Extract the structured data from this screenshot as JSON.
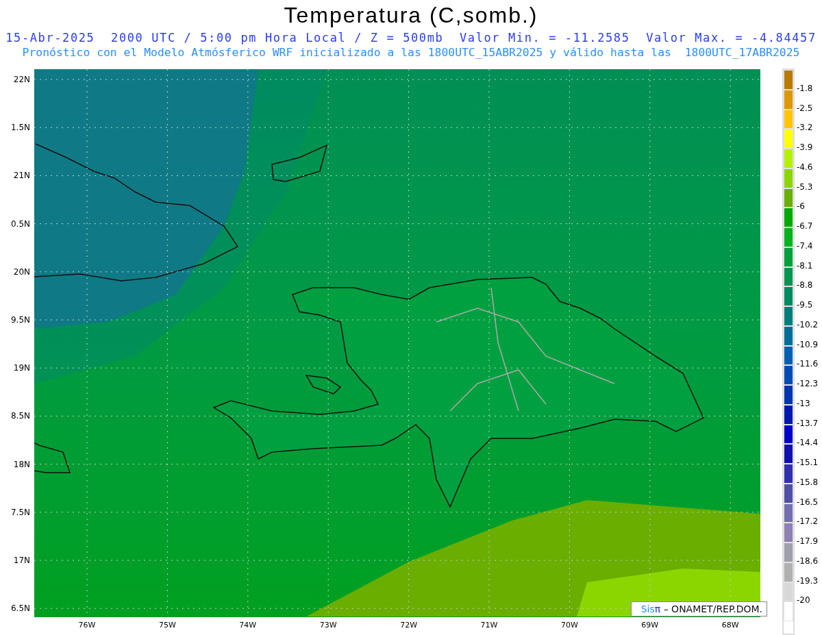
{
  "title": "Temperatura (C,somb.)",
  "subtitle": "15-Abr-2025  2000 UTC / 5:00 pm Hora Local / Z = 500mb  Valor Min. = -11.2585  Valor Max. = -4.84457",
  "description": "Pronóstico con el Modelo Atmósferico WRF inicializado a las 1800UTC_15ABR2025 y válido hasta las  1800UTC_17ABR2025",
  "map": {
    "y_axis_labels": [
      "22N",
      "1.5N",
      "21N",
      "0.5N",
      "20N",
      "9.5N",
      "19N",
      "8.5N",
      "18N",
      "7.5N",
      "17N",
      "6.5N"
    ],
    "x_axis_labels": [
      "76W",
      "75W",
      "74W",
      "73W",
      "72W",
      "71W",
      "70W",
      "69W",
      "68W"
    ],
    "credit": {
      "logo": "Sis",
      "symbol": "π",
      "text": "– ONAMET/REP.DOM."
    }
  },
  "legend": {
    "swatches": [
      {
        "color": "#bb7a00"
      },
      {
        "color": "#df9700"
      },
      {
        "color": "#ffc400"
      },
      {
        "color": "#ffff00"
      },
      {
        "color": "#b4f000"
      },
      {
        "color": "#8cd600"
      },
      {
        "color": "#6aae00"
      },
      {
        "color": "#00aa00"
      },
      {
        "color": "#00b41e"
      },
      {
        "color": "#00a03c"
      },
      {
        "color": "#009650"
      },
      {
        "color": "#008a64"
      },
      {
        "color": "#007f7a"
      },
      {
        "color": "#006e98"
      },
      {
        "color": "#0060b4"
      },
      {
        "color": "#004cb4"
      },
      {
        "color": "#0034b0"
      },
      {
        "color": "#0018b0"
      },
      {
        "color": "#0000c8"
      },
      {
        "color": "#1010b0"
      },
      {
        "color": "#3030b0"
      },
      {
        "color": "#5050a8"
      },
      {
        "color": "#7070b0"
      },
      {
        "color": "#9080b0"
      },
      {
        "color": "#a0a0ac"
      },
      {
        "color": "#b0b0b0"
      },
      {
        "color": "#d8d8d8"
      },
      {
        "color": "#ffffff"
      }
    ],
    "labels": [
      "-1.8",
      "-2.5",
      "-3.2",
      "-3.9",
      "-4.6",
      "-5.3",
      "-6",
      "-6.7",
      "-7.4",
      "-8.1",
      "-8.8",
      "-9.5",
      "-10.2",
      "-10.9",
      "-11.6",
      "-12.3",
      "-13",
      "-13.7",
      "-14.4",
      "-15.1",
      "-15.8",
      "-16.5",
      "-17.2",
      "-17.9",
      "-18.6",
      "-19.3",
      "-20"
    ]
  }
}
